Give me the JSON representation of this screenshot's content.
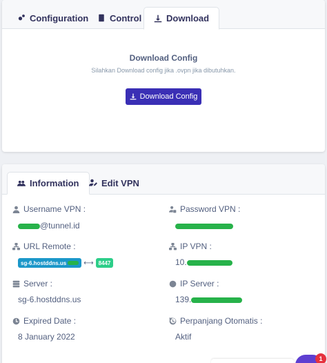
{
  "top_tabs": [
    {
      "label": "Configuration",
      "icon": "gears-icon"
    },
    {
      "label": "Control",
      "icon": "building-icon"
    },
    {
      "label": "Download",
      "icon": "download-icon"
    }
  ],
  "download": {
    "title": "Download Config",
    "subtitle": "Silahkan Download config jika .ovpn jika dibutuhkan.",
    "button_label": "Download Config"
  },
  "bottom_tabs": [
    {
      "label": "Information",
      "icon": "users-icon"
    },
    {
      "label": "Edit VPN",
      "icon": "user-edit-icon"
    }
  ],
  "info": {
    "username": {
      "label": "Username VPN :",
      "value_suffix": "@tunnel.id"
    },
    "password": {
      "label": "Password VPN :"
    },
    "url_remote": {
      "label": "URL Remote :",
      "host": "sg-6.hostddns.us",
      "port": "8447"
    },
    "ip_vpn": {
      "label": "IP VPN :",
      "value_prefix": "10."
    },
    "server": {
      "label": "Server :",
      "value": "sg-6.hostddns.us"
    },
    "ip_server": {
      "label": "IP Server :",
      "value_prefix": "139."
    },
    "expired": {
      "label": "Expired Date :",
      "value": "8 January 2022"
    },
    "auto_renew": {
      "label": "Perpanjang Otomatis :",
      "value": "Aktif"
    }
  },
  "notification": {
    "count": "1"
  },
  "colors": {
    "primary": "#3a2fb5",
    "mask": "#27b24a",
    "url_pill": "#1b97c9",
    "port_pill": "#2dce89",
    "badge": "#e5323e"
  }
}
